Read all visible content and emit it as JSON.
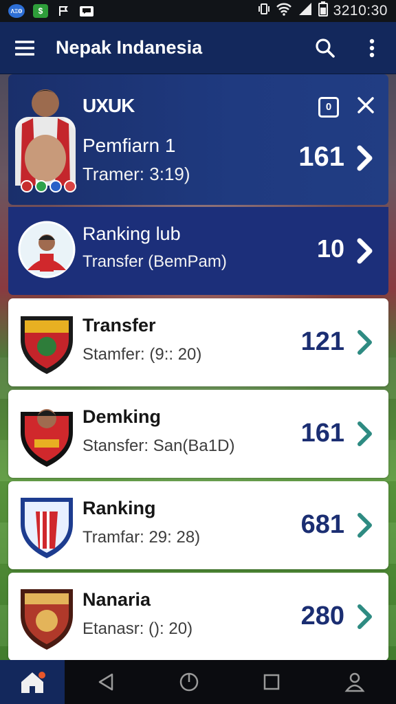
{
  "status_bar": {
    "left_icons": [
      "app-badge-icon",
      "dollar-app-icon",
      "flag-app-icon",
      "message-app-icon"
    ],
    "labels": {
      "badge": "ΛΞΘ",
      "dollar": "$"
    },
    "right_icons": [
      "vibrate-icon",
      "wifi-icon",
      "signal-icon",
      "battery-icon"
    ],
    "clock": "3210:30"
  },
  "app_bar": {
    "title": "Nepak Indanesia",
    "icons": [
      "menu-icon",
      "search-icon",
      "more-vert-icon"
    ]
  },
  "cards": [
    {
      "style": "dark",
      "header": "UXUK",
      "title": "Pemfiarn 1",
      "subtitle": "Tramer: 3:19)",
      "value": "161",
      "tools": {
        "box_label": "0"
      },
      "avatar": "player-photo-icon"
    },
    {
      "style": "blue",
      "title": "Ranking lub",
      "subtitle": "Transfer (BemPam)",
      "value": "10",
      "avatar": "player-avatar-icon"
    },
    {
      "style": "light",
      "title": "Transfer",
      "subtitle": "Stamfer: (9:: 20)",
      "value": "121",
      "avatar": "club-crest-icon"
    },
    {
      "style": "light",
      "title": "Demking",
      "subtitle": "Stansfer: San(Ba1D)",
      "value": "161",
      "avatar": "player-crest-icon"
    },
    {
      "style": "light",
      "title": "Ranking",
      "subtitle": "Tramfar: 29: 28)",
      "value": "681",
      "avatar": "club-crest-icon"
    },
    {
      "style": "light",
      "title": "Nanaria",
      "subtitle": "Etanasr: (): 20)",
      "value": "280",
      "avatar": "club-crest-icon"
    }
  ],
  "bottom_nav": [
    "home-icon",
    "back-icon",
    "power-icon",
    "recents-icon",
    "profile-icon"
  ],
  "colors": {
    "app_bar": "#13285c",
    "accent_chevron": "#2e8b82",
    "value_text": "#1b2e72"
  }
}
